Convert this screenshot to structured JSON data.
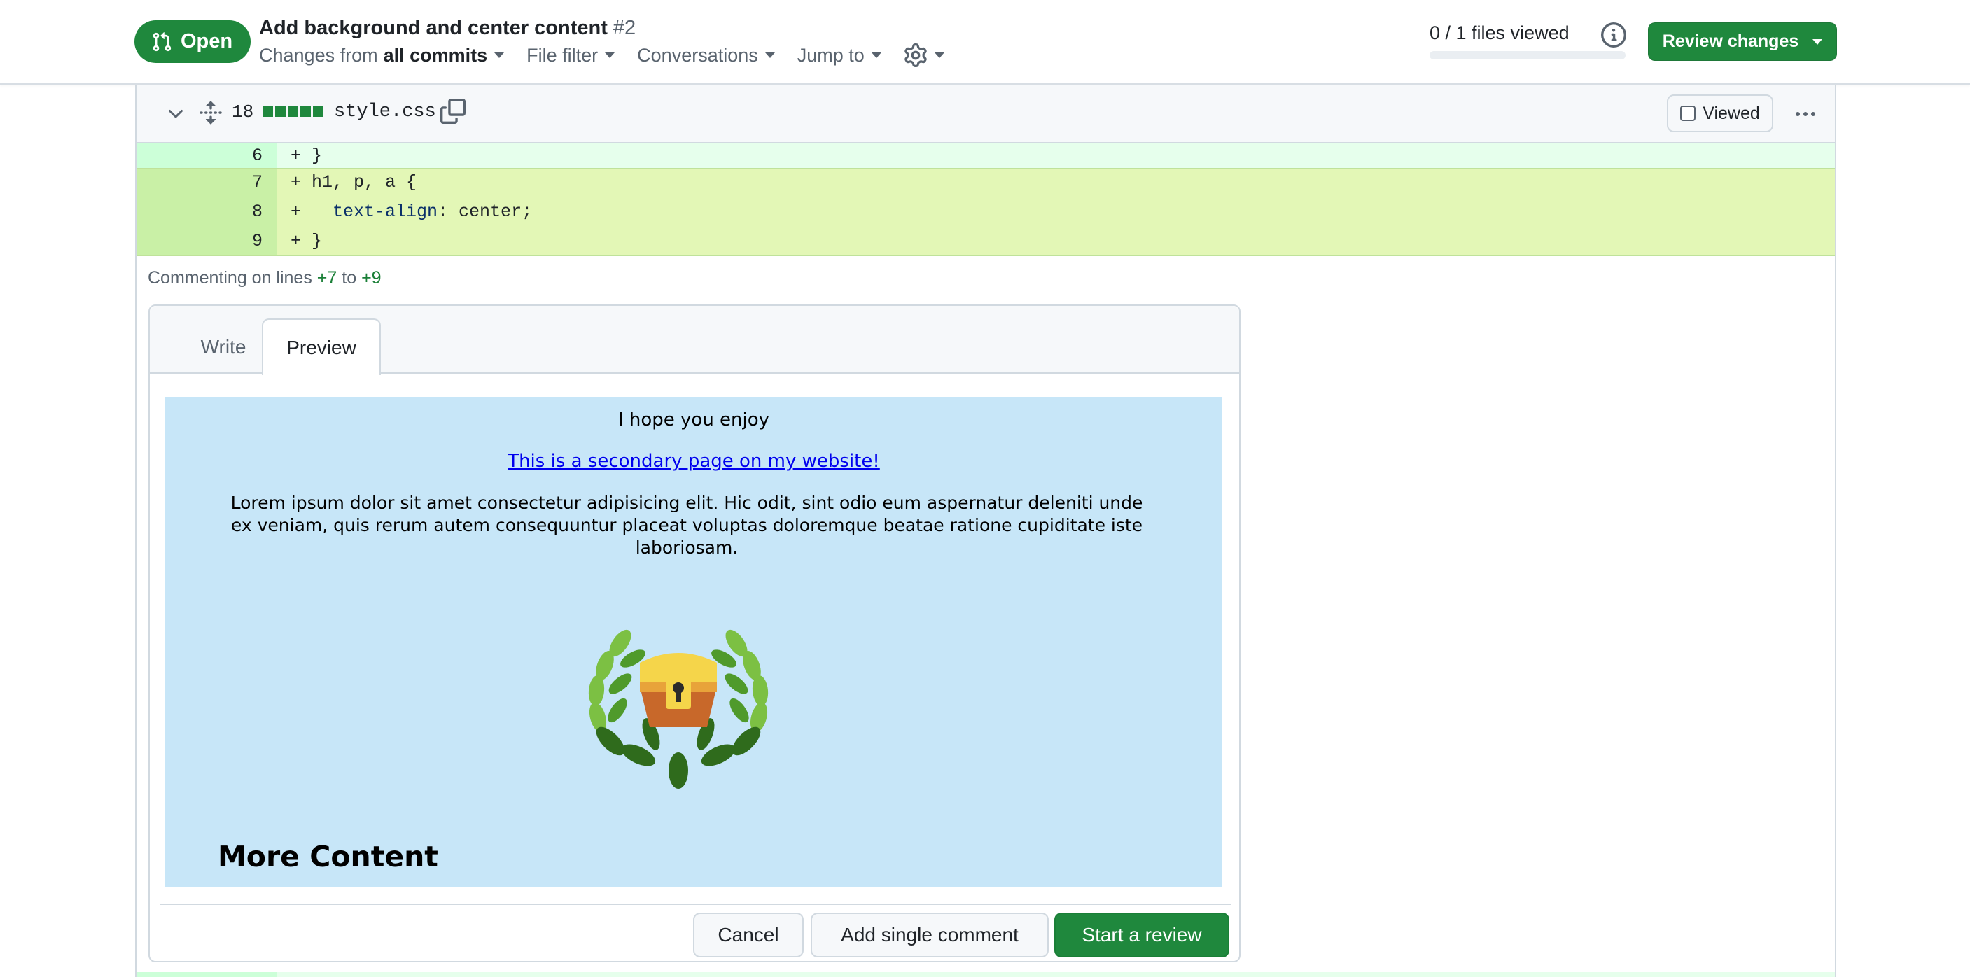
{
  "header": {
    "state": "Open",
    "title": "Add background and center content",
    "number": "#2",
    "toolbar": {
      "changes_prefix": "Changes from",
      "changes_value": "all commits",
      "file_filter": "File filter",
      "conversations": "Conversations",
      "jump_to": "Jump to"
    },
    "files_viewed": "0 / 1 files viewed",
    "files_viewed_progress": 0,
    "review_button": "Review changes"
  },
  "file": {
    "changes_count": "18",
    "name": "style.css",
    "viewed_label": "Viewed",
    "lines": [
      {
        "num": "6",
        "code": "+ }"
      },
      {
        "num": "7",
        "code": "+ h1, p, a {"
      },
      {
        "num": "8",
        "prefix": "+   ",
        "prop": "text-align",
        "rest": ": center;"
      },
      {
        "num": "9",
        "code": "+ }"
      }
    ]
  },
  "comment": {
    "commenting_prefix": "Commenting on lines",
    "line_start": "+7",
    "to": "to",
    "line_end": "+9",
    "tabs": {
      "write": "Write",
      "preview": "Preview"
    },
    "preview": {
      "hope": "I hope you enjoy",
      "link": "This is a secondary page on my website!",
      "lorem": "Lorem ipsum dolor sit amet consectetur adipisicing elit. Hic odit, sint odio eum aspernatur deleniti unde ex veniam, quis rerum autem consequuntur placeat voluptas doloremque beatae ratione cupiditate iste laboriosam.",
      "heading": "More Content"
    },
    "buttons": {
      "cancel": "Cancel",
      "single": "Add single comment",
      "start": "Start a review"
    }
  },
  "colors": {
    "accent_green": "#1f883d",
    "preview_bg": "#c7e6f8",
    "added_line_bg": "#e6ffec",
    "selected_line_bg": "#e3f7b6"
  },
  "icons": [
    "git-pull-request-icon",
    "caret-down-icon",
    "gear-icon",
    "info-icon",
    "chevron-down-icon",
    "unfold-icon",
    "copy-icon",
    "kebab-horizontal-icon",
    "treasure-chest-logo"
  ]
}
